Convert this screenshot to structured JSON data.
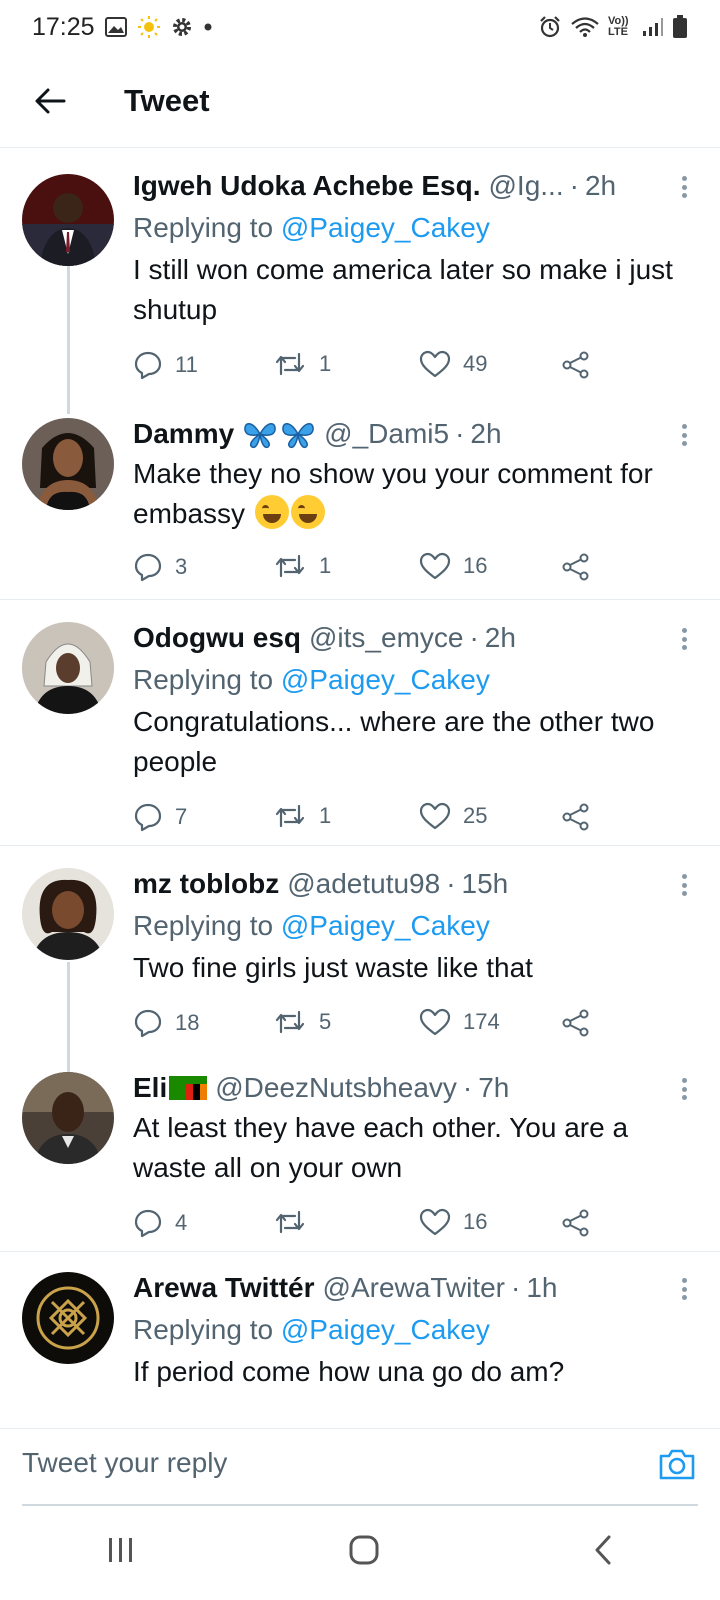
{
  "status_bar": {
    "time": "17:25",
    "network_label": "Vo)) LTE"
  },
  "header": {
    "title": "Tweet"
  },
  "tweets": [
    {
      "name": "Igweh Udoka Achebe Esq.",
      "handle": "@Ig...",
      "time": "2h",
      "replying_prefix": "Replying to ",
      "replying_to": "@Paigey_Cakey",
      "text": "I still won come america later so make i just shutup",
      "replies": "11",
      "retweets": "1",
      "likes": "49"
    },
    {
      "name": "Dammy",
      "handle": "@_Dami5",
      "time": "2h",
      "text": "Make they no show you your comment for embassy",
      "replies": "3",
      "retweets": "1",
      "likes": "16"
    },
    {
      "name": "Odogwu esq",
      "handle": "@its_emyce",
      "time": "2h",
      "replying_prefix": "Replying to ",
      "replying_to": "@Paigey_Cakey",
      "text": "Congratulations... where are the other two people",
      "replies": "7",
      "retweets": "1",
      "likes": "25"
    },
    {
      "name": "mz toblobz",
      "handle": "@adetutu98",
      "time": "15h",
      "replying_prefix": "Replying to ",
      "replying_to": "@Paigey_Cakey",
      "text": "Two fine girls just waste like that",
      "replies": "18",
      "retweets": "5",
      "likes": "174"
    },
    {
      "name": "Eli",
      "handle": "@DeezNutsbheavy",
      "time": "7h",
      "text": "At least they have each other. You are a waste all on your own",
      "replies": "4",
      "retweets": "",
      "likes": "16"
    },
    {
      "name": "Arewa Twittér",
      "handle": "@ArewaTwiter",
      "time": "1h",
      "replying_prefix": "Replying to ",
      "replying_to": "@Paigey_Cakey",
      "text": "If period come how una go do am?"
    }
  ],
  "compose": {
    "placeholder": "Tweet your reply"
  },
  "colors": {
    "accent": "#1d9bf0",
    "secondary_text": "#536471",
    "divider": "#e6ecf0"
  }
}
